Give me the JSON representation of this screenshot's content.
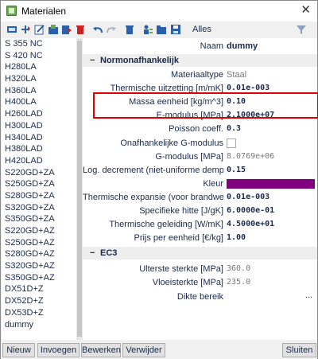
{
  "window": {
    "title": "Materialen",
    "close_glyph": "✕"
  },
  "toolbar": {
    "icons": [
      "new-material-icon",
      "copy-icon",
      "edit-icon",
      "import-icon",
      "export-icon",
      "delete-icon",
      "undo-icon",
      "redo-icon",
      "trash-icon",
      "user-list-icon",
      "folder-icon",
      "save-icon",
      "filter-icon"
    ],
    "filter_label": "Alles",
    "accent_delete": "#cc2222",
    "accent_blue": "#2b5fa8"
  },
  "materials": [
    "S 355 NC",
    "S 420 NC",
    "H280LA",
    "H320LA",
    "H360LA",
    "H400LA",
    "H260LAD",
    "H300LAD",
    "H340LAD",
    "H380LAD",
    "H420LAD",
    "S220GD+ZA",
    "S250GD+ZA",
    "S280GD+ZA",
    "S320GD+ZA",
    "S350GD+ZA",
    "S220GD+AZ",
    "S250GD+AZ",
    "S280GD+AZ",
    "S320GD+AZ",
    "S350GD+AZ",
    "DX51D+Z",
    "DX52D+Z",
    "DX53D+Z",
    "dummy"
  ],
  "properties": {
    "name_label": "Naam",
    "name_value": "dummy",
    "section1": "Normonafhankelijk",
    "section1_toggle": "−",
    "rows": [
      {
        "label": "Materiaaltype",
        "value": "Staal"
      },
      {
        "label": "Thermische uitzetting [m/mK]",
        "value": "0.01e-003"
      },
      {
        "label": "Massa eenheid [kg/m^3]",
        "value": "0.10"
      },
      {
        "label": "E-modulus [MPa]",
        "value": "2.1000e+07"
      },
      {
        "label": "Poisson coeff.",
        "value": "0.3"
      },
      {
        "label": "Onafhankelijke G-modulus",
        "value": ""
      },
      {
        "label": "G-modulus [MPa]",
        "value": "8.0769e+06"
      },
      {
        "label": "Log. decrement (niet-uniforme dempin",
        "value": "0.15"
      },
      {
        "label": "Kleur",
        "value": "#800080"
      },
      {
        "label": "Thermische expansie (voor brandwere",
        "value": "0.01e-003"
      },
      {
        "label": "Specifieke hitte [J/gK]",
        "value": "6.0000e-01"
      },
      {
        "label": "Thermische geleiding [W/mK]",
        "value": "4.5000e+01"
      },
      {
        "label": "Prijs per eenheid [€/kg]",
        "value": "1.00"
      }
    ],
    "section2": "EC3",
    "section2_toggle": "−",
    "rows2": [
      {
        "label": "Ulterste sterkte [MPa]",
        "value": "360.0"
      },
      {
        "label": "Vloeisterkte [MPa]",
        "value": "235.0"
      },
      {
        "label": "Dikte bereik",
        "value": "..."
      }
    ]
  },
  "buttons": {
    "new": "Nieuw",
    "import": "Invoegen",
    "edit": "Bewerken",
    "delete": "Verwijder",
    "close": "Sluiten"
  },
  "highlight_color": "#e00000"
}
